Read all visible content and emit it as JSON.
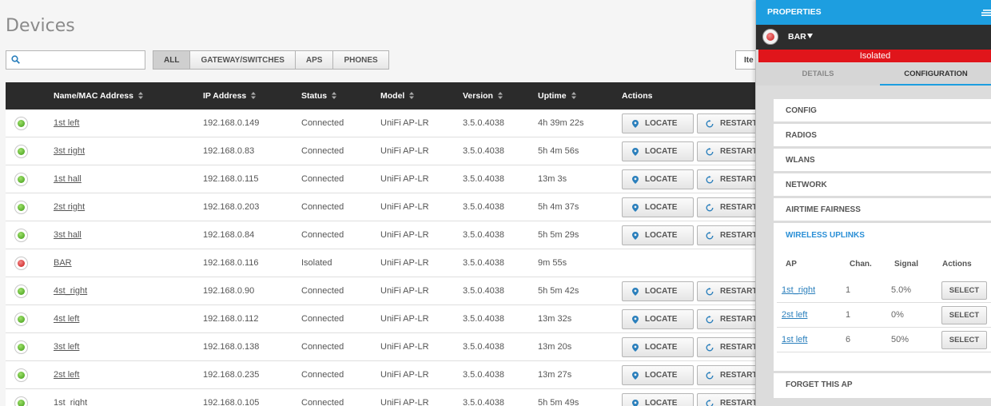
{
  "page": {
    "title": "Devices"
  },
  "search": {
    "placeholder": "",
    "value": ""
  },
  "filters": [
    {
      "label": "ALL",
      "active": true
    },
    {
      "label": "GATEWAY/SWITCHES",
      "active": false
    },
    {
      "label": "APS",
      "active": false
    },
    {
      "label": "PHONES",
      "active": false
    }
  ],
  "items_per_page": {
    "label": "Ite"
  },
  "table": {
    "columns": [
      "Name/MAC Address",
      "IP Address",
      "Status",
      "Model",
      "Version",
      "Uptime",
      "Actions"
    ],
    "action_labels": {
      "locate": "LOCATE",
      "restart": "RESTART"
    },
    "rows": [
      {
        "name": "1st left",
        "ip": "192.168.0.149",
        "status": "Connected",
        "model": "UniFi AP-LR",
        "version": "3.5.0.4038",
        "uptime": "4h 39m 22s"
      },
      {
        "name": "3st right",
        "ip": "192.168.0.83",
        "status": "Connected",
        "model": "UniFi AP-LR",
        "version": "3.5.0.4038",
        "uptime": "5h 4m 56s"
      },
      {
        "name": "1st hall",
        "ip": "192.168.0.115",
        "status": "Connected",
        "model": "UniFi AP-LR",
        "version": "3.5.0.4038",
        "uptime": "13m 3s"
      },
      {
        "name": "2st right",
        "ip": "192.168.0.203",
        "status": "Connected",
        "model": "UniFi AP-LR",
        "version": "3.5.0.4038",
        "uptime": "5h 4m 37s"
      },
      {
        "name": "3st hall",
        "ip": "192.168.0.84",
        "status": "Connected",
        "model": "UniFi AP-LR",
        "version": "3.5.0.4038",
        "uptime": "5h 5m 29s"
      },
      {
        "name": "BAR",
        "ip": "192.168.0.116",
        "status": "Isolated",
        "model": "UniFi AP-LR",
        "version": "3.5.0.4038",
        "uptime": "9m 55s"
      },
      {
        "name": "4st_right",
        "ip": "192.168.0.90",
        "status": "Connected",
        "model": "UniFi AP-LR",
        "version": "3.5.0.4038",
        "uptime": "5h 5m 42s"
      },
      {
        "name": "4st left",
        "ip": "192.168.0.112",
        "status": "Connected",
        "model": "UniFi AP-LR",
        "version": "3.5.0.4038",
        "uptime": "13m 32s"
      },
      {
        "name": "3st left",
        "ip": "192.168.0.138",
        "status": "Connected",
        "model": "UniFi AP-LR",
        "version": "3.5.0.4038",
        "uptime": "13m 20s"
      },
      {
        "name": "2st left",
        "ip": "192.168.0.235",
        "status": "Connected",
        "model": "UniFi AP-LR",
        "version": "3.5.0.4038",
        "uptime": "13m 27s"
      },
      {
        "name": "1st_right",
        "ip": "192.168.0.105",
        "status": "Connected",
        "model": "UniFi AP-LR",
        "version": "3.5.0.4038",
        "uptime": "5h 5m 49s"
      }
    ]
  },
  "panel": {
    "title": "PROPERTIES",
    "device_name": "BAR",
    "banner": "Isolated",
    "tabs": [
      {
        "label": "DETAILS",
        "active": false
      },
      {
        "label": "CONFIGURATION",
        "active": true
      }
    ],
    "sections": [
      "CONFIG",
      "RADIOS",
      "WLANS",
      "NETWORK",
      "AIRTIME FAIRNESS"
    ],
    "uplinks": {
      "title": "WIRELESS UPLINKS",
      "columns": [
        "AP",
        "Chan.",
        "Signal",
        "Actions"
      ],
      "select_label": "SELECT",
      "rows": [
        {
          "ap": "1st_right",
          "chan": "1",
          "signal": "5.0%"
        },
        {
          "ap": "2st left",
          "chan": "1",
          "signal": "0%"
        },
        {
          "ap": "1st left",
          "chan": "6",
          "signal": "50%"
        }
      ]
    },
    "forget": "FORGET THIS AP"
  },
  "colors": {
    "accent": "#1d9ee0",
    "connected": "#4a9a2a",
    "isolated": "#dd1111",
    "banner": "#e0151b",
    "header_dark": "#2b2b2b"
  }
}
